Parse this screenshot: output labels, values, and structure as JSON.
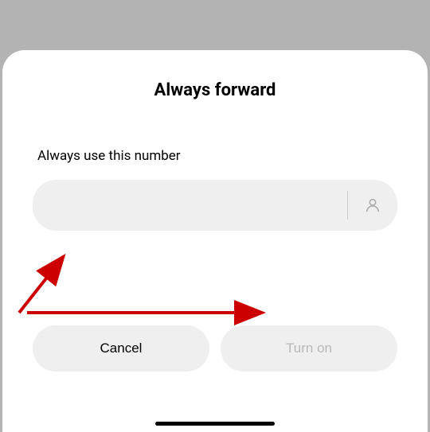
{
  "dialog": {
    "title": "Always forward",
    "field_label": "Always use this number",
    "input_value": "",
    "input_placeholder": "",
    "cancel_label": "Cancel",
    "confirm_label": "Turn on",
    "contact_icon": "person-icon"
  },
  "annotations": {
    "arrow1_color": "#cc0000",
    "arrow2_color": "#cc0000"
  }
}
